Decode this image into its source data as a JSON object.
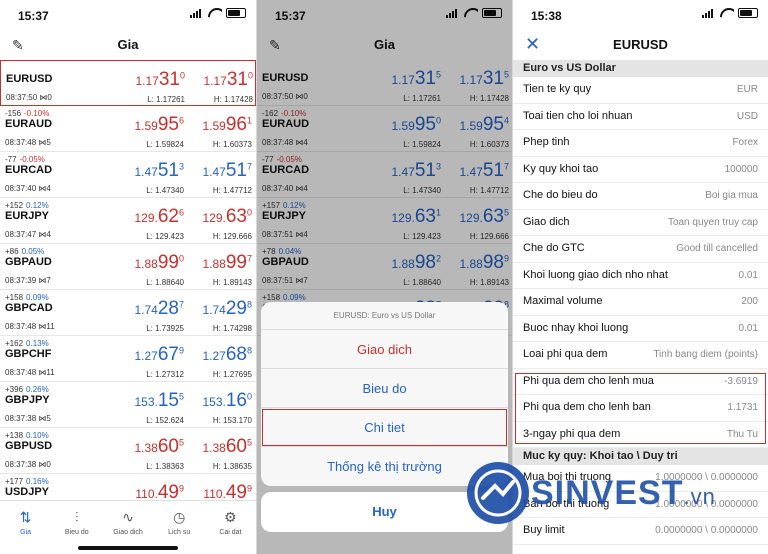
{
  "colors": {
    "accent": "#2463c7",
    "down": "#c9302c",
    "highlight": "#c9302c"
  },
  "left": {
    "status_time": "15:37",
    "title": "Gia",
    "quotes": [
      {
        "chg": "",
        "pct": "",
        "pct_dir": "neg",
        "symbol": "EURUSD",
        "time": "08:37:50",
        "spread": "0",
        "bid": {
          "a": "1.17",
          "b": "31",
          "c": "0",
          "color": "red"
        },
        "ask": {
          "a": "1.17",
          "b": "31",
          "c": "0",
          "color": "red"
        },
        "low": "L: 1.17261",
        "high": "H: 1.17428"
      },
      {
        "chg": "-156",
        "pct": "-0.10%",
        "pct_dir": "neg",
        "symbol": "EURAUD",
        "time": "08:37:48",
        "spread": "5",
        "bid": {
          "a": "1.59",
          "b": "95",
          "c": "6",
          "color": "red"
        },
        "ask": {
          "a": "1.59",
          "b": "96",
          "c": "1",
          "color": "red"
        },
        "low": "L: 1.59824",
        "high": "H: 1.60373"
      },
      {
        "chg": "-77",
        "pct": "-0.05%",
        "pct_dir": "neg",
        "symbol": "EURCAD",
        "time": "08:37:40",
        "spread": "4",
        "bid": {
          "a": "1.47",
          "b": "51",
          "c": "3",
          "color": "blue"
        },
        "ask": {
          "a": "1.47",
          "b": "51",
          "c": "7",
          "color": "blue"
        },
        "low": "L: 1.47340",
        "high": "H: 1.47712"
      },
      {
        "chg": "+152",
        "pct": "0.12%",
        "pct_dir": "pos",
        "symbol": "EURJPY",
        "time": "08:37:47",
        "spread": "4",
        "bid": {
          "a": "129.",
          "b": "62",
          "c": "6",
          "color": "red"
        },
        "ask": {
          "a": "129.",
          "b": "63",
          "c": "0",
          "color": "red"
        },
        "low": "L: 129.423",
        "high": "H: 129.666"
      },
      {
        "chg": "+86",
        "pct": "0.05%",
        "pct_dir": "pos",
        "symbol": "GBPAUD",
        "time": "08:37:39",
        "spread": "7",
        "bid": {
          "a": "1.88",
          "b": "99",
          "c": "0",
          "color": "red"
        },
        "ask": {
          "a": "1.88",
          "b": "99",
          "c": "7",
          "color": "red"
        },
        "low": "L: 1.88640",
        "high": "H: 1.89143"
      },
      {
        "chg": "+158",
        "pct": "0.09%",
        "pct_dir": "pos",
        "symbol": "GBPCAD",
        "time": "08:37:48",
        "spread": "11",
        "bid": {
          "a": "1.74",
          "b": "28",
          "c": "7",
          "color": "blue"
        },
        "ask": {
          "a": "1.74",
          "b": "29",
          "c": "8",
          "color": "blue"
        },
        "low": "L: 1.73925",
        "high": "H: 1.74298"
      },
      {
        "chg": "+162",
        "pct": "0.13%",
        "pct_dir": "pos",
        "symbol": "GBPCHF",
        "time": "08:37:48",
        "spread": "11",
        "bid": {
          "a": "1.27",
          "b": "67",
          "c": "9",
          "color": "blue"
        },
        "ask": {
          "a": "1.27",
          "b": "68",
          "c": "8",
          "color": "blue"
        },
        "low": "L: 1.27312",
        "high": "H: 1.27695"
      },
      {
        "chg": "+396",
        "pct": "0.26%",
        "pct_dir": "pos",
        "symbol": "GBPJPY",
        "time": "08:37:38",
        "spread": "5",
        "bid": {
          "a": "153.",
          "b": "15",
          "c": "5",
          "color": "blue"
        },
        "ask": {
          "a": "153.",
          "b": "16",
          "c": "0",
          "color": "blue"
        },
        "low": "L: 152.624",
        "high": "H: 153.170"
      },
      {
        "chg": "+138",
        "pct": "0.10%",
        "pct_dir": "pos",
        "symbol": "GBPUSD",
        "time": "08:37:38",
        "spread": "0",
        "bid": {
          "a": "1.38",
          "b": "60",
          "c": "5",
          "color": "red"
        },
        "ask": {
          "a": "1.38",
          "b": "60",
          "c": "5",
          "color": "red"
        },
        "low": "L: 1.38363",
        "high": "H: 1.38635"
      },
      {
        "chg": "+177",
        "pct": "0.16%",
        "pct_dir": "pos",
        "symbol": "USDJPY",
        "time": "",
        "spread": "",
        "bid": {
          "a": "110.",
          "b": "49",
          "c": "9",
          "color": "red"
        },
        "ask": {
          "a": "110.",
          "b": "49",
          "c": "9",
          "color": "red"
        },
        "low": "",
        "high": ""
      }
    ],
    "tabs": [
      {
        "label": "Gia",
        "icon": "⇅"
      },
      {
        "label": "Bieu do",
        "icon": "⫶"
      },
      {
        "label": "Giao dich",
        "icon": "∿"
      },
      {
        "label": "Lich su",
        "icon": "◷"
      },
      {
        "label": "Cai dat",
        "icon": "⚙"
      }
    ]
  },
  "middle": {
    "status_time": "15:37",
    "title": "Gia",
    "quotes": [
      {
        "chg": "",
        "pct": "",
        "pct_dir": "neg",
        "symbol": "EURUSD",
        "time": "08:37:50",
        "spread": "0",
        "bid": {
          "a": "1.17",
          "b": "31",
          "c": "5",
          "color": "blue"
        },
        "ask": {
          "a": "1.17",
          "b": "31",
          "c": "5",
          "color": "blue"
        },
        "low": "L: 1.17261",
        "high": "H: 1.17428"
      },
      {
        "chg": "-162",
        "pct": "-0.10%",
        "pct_dir": "neg",
        "symbol": "EURAUD",
        "time": "08:37:48",
        "spread": "4",
        "bid": {
          "a": "1.59",
          "b": "95",
          "c": "0",
          "color": "blue"
        },
        "ask": {
          "a": "1.59",
          "b": "95",
          "c": "4",
          "color": "blue"
        },
        "low": "L: 1.59824",
        "high": "H: 1.60373"
      },
      {
        "chg": "-77",
        "pct": "-0.05%",
        "pct_dir": "neg",
        "symbol": "EURCAD",
        "time": "08:37:40",
        "spread": "4",
        "bid": {
          "a": "1.47",
          "b": "51",
          "c": "3",
          "color": "blue"
        },
        "ask": {
          "a": "1.47",
          "b": "51",
          "c": "7",
          "color": "blue"
        },
        "low": "L: 1.47340",
        "high": "H: 1.47712"
      },
      {
        "chg": "+157",
        "pct": "0.12%",
        "pct_dir": "pos",
        "symbol": "EURJPY",
        "time": "08:37:51",
        "spread": "4",
        "bid": {
          "a": "129.",
          "b": "63",
          "c": "1",
          "color": "blue"
        },
        "ask": {
          "a": "129.",
          "b": "63",
          "c": "5",
          "color": "blue"
        },
        "low": "L: 129.423",
        "high": "H: 129.666"
      },
      {
        "chg": "+78",
        "pct": "0.04%",
        "pct_dir": "pos",
        "symbol": "GBPAUD",
        "time": "08:37:51",
        "spread": "7",
        "bid": {
          "a": "1.88",
          "b": "98",
          "c": "2",
          "color": "blue"
        },
        "ask": {
          "a": "1.88",
          "b": "98",
          "c": "9",
          "color": "blue"
        },
        "low": "L: 1.88640",
        "high": "H: 1.89143"
      },
      {
        "chg": "+158",
        "pct": "0.09%",
        "pct_dir": "pos",
        "symbol": "GBPCAD",
        "time": "",
        "spread": "",
        "bid": {
          "a": "1.74",
          "b": "28",
          "c": "7",
          "color": "blue"
        },
        "ask": {
          "a": "1.74",
          "b": "29",
          "c": "8",
          "color": "blue"
        },
        "low": "",
        "high": ""
      }
    ],
    "sheet": {
      "header": "EURUSD: Euro vs US Dollar",
      "actions": [
        "Giao dich",
        "Bieu do",
        "Chi tiet",
        "Thống kê thị trường"
      ],
      "cancel": "Huy"
    }
  },
  "right": {
    "status_time": "15:38",
    "title": "EURUSD",
    "section1": "Euro vs US Dollar",
    "specs": [
      {
        "k": "Tien te ky quy",
        "v": "EUR"
      },
      {
        "k": "Toai tien cho loi nhuan",
        "v": "USD"
      },
      {
        "k": "Phep tinh",
        "v": "Forex"
      },
      {
        "k": "Ky quy khoi tao",
        "v": "100000"
      },
      {
        "k": "Che do bieu do",
        "v": "Boi gia mua"
      },
      {
        "k": "Giao dich",
        "v": "Toan quyen truy cap"
      },
      {
        "k": "Che do GTC",
        "v": "Good till cancelled"
      },
      {
        "k": "Khoi luong giao dich nho nhat",
        "v": "0.01"
      },
      {
        "k": "Maximal volume",
        "v": "200"
      },
      {
        "k": "Buoc nhay khoi luong",
        "v": "0.01"
      },
      {
        "k": "Loai phi qua dem",
        "v": "Tinh bang diem (points)"
      },
      {
        "k": "Phi qua dem cho lenh mua",
        "v": "-3.6919"
      },
      {
        "k": "Phi qua dem cho lenh ban",
        "v": "1.1731"
      },
      {
        "k": "3-ngay phi qua dem",
        "v": "Thu Tu"
      }
    ],
    "section2": "Muc ky quy: Khoi tao \\ Duy tri",
    "margins": [
      {
        "k": "Mua boi thi truong",
        "v": "1.0000000 \\ 0.0000000"
      },
      {
        "k": "Ban boi thi truong",
        "v": "1.0000000 \\ 0.0000000"
      },
      {
        "k": "Buy limit",
        "v": "0.0000000 \\ 0.0000000"
      }
    ]
  },
  "watermark": {
    "brand": "SINVEST",
    "suffix": ".vn"
  }
}
